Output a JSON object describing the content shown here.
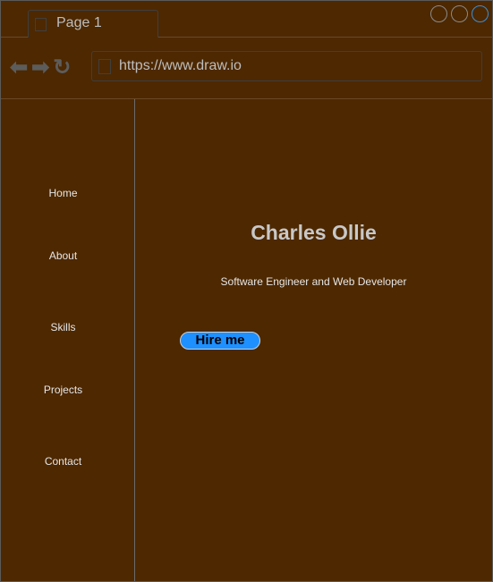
{
  "browser": {
    "tab_label": "Page 1",
    "url": "https://www.draw.io",
    "icons": [
      "back-arrow-icon",
      "forward-arrow-icon",
      "reload-icon",
      "page-icon"
    ],
    "window_controls": [
      "minimize",
      "maximize",
      "close"
    ]
  },
  "sidebar": {
    "items": [
      {
        "label": "Home"
      },
      {
        "label": "About"
      },
      {
        "label": "Skills"
      },
      {
        "label": "Projects"
      },
      {
        "label": "Contact"
      }
    ]
  },
  "hero": {
    "name": "Charles Ollie",
    "tagline": "Software Engineer and Web Developer",
    "cta_label": "Hire me"
  },
  "colors": {
    "background": "#4d2800",
    "button": "#1e90ff",
    "text": "#e6e6e6"
  }
}
